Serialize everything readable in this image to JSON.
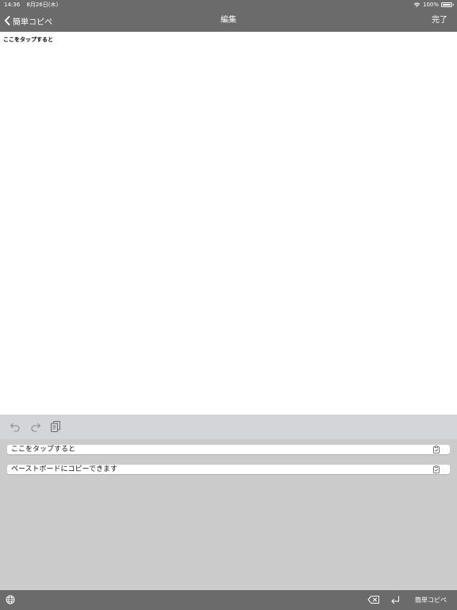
{
  "status_bar": {
    "time": "14:36",
    "date": "8月26日(木)",
    "battery": "100%",
    "wifi_icon": "wifi-icon",
    "battery_icon": "battery-icon"
  },
  "nav": {
    "back_label": "簡単コピペ",
    "title": "編集",
    "done_label": "完了",
    "bar_color": "#6b6b6b"
  },
  "editor": {
    "text": "ここをタップすると"
  },
  "toolbar": {
    "icons": [
      "undo-icon",
      "redo-icon",
      "copy-icon"
    ]
  },
  "clipboard": {
    "items": [
      {
        "text": "ここをタップすると",
        "icon": "paste-icon"
      },
      {
        "text": "ペーストボードにコピーできます",
        "icon": "paste-icon"
      }
    ]
  },
  "bottom_bar": {
    "keyboard_name": "簡単コピペ",
    "icons": [
      "globe-icon",
      "delete-icon",
      "return-icon"
    ]
  }
}
